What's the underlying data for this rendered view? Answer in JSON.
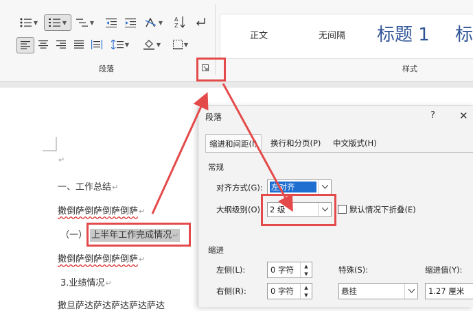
{
  "ribbon": {
    "paragraph_group_label": "段落",
    "styles_group_label": "样式",
    "styles": [
      {
        "label": "正文"
      },
      {
        "label": "无间隔"
      },
      {
        "label": "标题 1"
      },
      {
        "label": "标"
      }
    ]
  },
  "document": {
    "lines": [
      "一、工作总结",
      "撒倒萨倒萨倒萨倒萨",
      "（一）",
      "上半年工作完成情况",
      "撒倒萨倒萨倒萨倒萨",
      "3.业绩情况",
      "撒旦萨达萨达萨达萨达萨达"
    ],
    "para_mark": "↵"
  },
  "dialog": {
    "title": "段落",
    "help": "?",
    "close": "✕",
    "tabs": [
      {
        "label": "缩进和间距(I)",
        "active": true
      },
      {
        "label": "换行和分页(P)",
        "active": false
      },
      {
        "label": "中文版式(H)",
        "active": false
      }
    ],
    "general_section": "常规",
    "alignment_label": "对齐方式(G):",
    "alignment_value": "左对齐",
    "outline_label": "大纲级别(O):",
    "outline_value": "2 级",
    "collapse_label": "默认情况下折叠(E)",
    "indent_section": "缩进",
    "left_label": "左侧(L):",
    "left_value": "0 字符",
    "right_label": "右侧(R):",
    "right_value": "0 字符",
    "special_label": "特殊(S):",
    "special_value": "悬挂",
    "indent_value_label": "缩进值(Y):",
    "indent_value": "1.27 厘米"
  },
  "colors": {
    "highlight_red": "#e44a4a",
    "selection_blue": "#1f6fd1",
    "style_blue": "#2f5597"
  }
}
